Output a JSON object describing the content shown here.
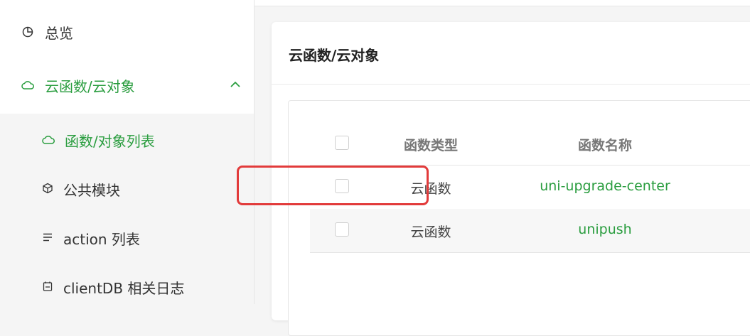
{
  "sidebar": {
    "overview_label": "总览",
    "cloud_label": "云函数/云对象",
    "sub_items": [
      {
        "label": "函数/对象列表"
      },
      {
        "label": "公共模块"
      },
      {
        "label": "action 列表"
      },
      {
        "label": "clientDB 相关日志"
      }
    ]
  },
  "card": {
    "title": "云函数/云对象"
  },
  "table": {
    "headers": [
      "函数类型",
      "函数名称"
    ],
    "rows": [
      {
        "type": "云函数",
        "name": "uni-upgrade-center"
      },
      {
        "type": "云函数",
        "name": "unipush"
      }
    ]
  },
  "colors": {
    "accent": "#2a9d3f",
    "highlight": "#e23b3b"
  }
}
